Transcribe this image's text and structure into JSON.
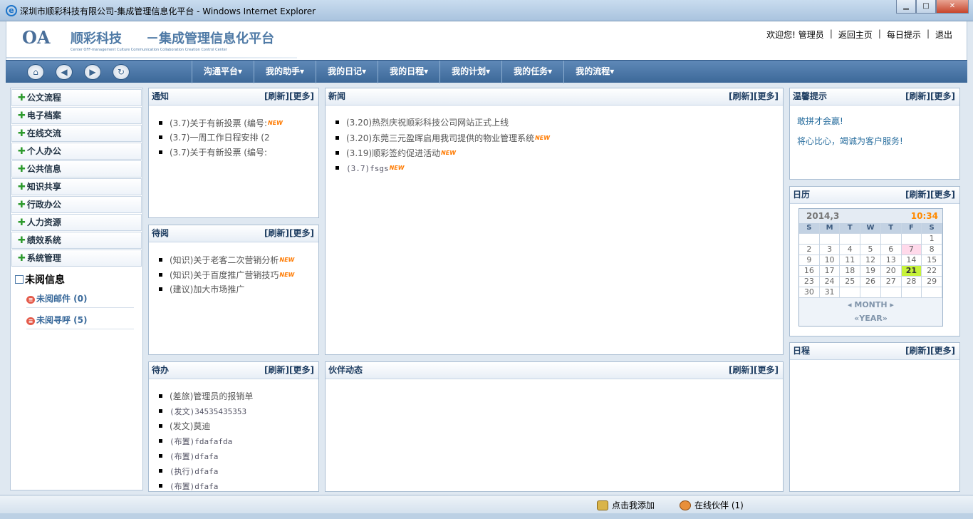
{
  "window": {
    "title": "深圳市顺彩科技有限公司-集成管理信息化平台 - Windows Internet Explorer",
    "minimize": "▁",
    "maximize": "□",
    "close": "✕"
  },
  "header": {
    "logo": "OA",
    "brand": "顺彩科技",
    "subtitle": "－集成管理信息化平台",
    "tagline": "Center OFF-management  Culture Communication Collaboration Creation Control Center",
    "links": {
      "welcome": "欢迎您! 管理员",
      "home": "返回主页",
      "daily_tip": "每日提示",
      "logout": "退出"
    }
  },
  "navbar": {
    "icons": [
      "home-icon",
      "back-icon",
      "forward-icon",
      "refresh-icon"
    ],
    "menu": [
      "沟通平台▾",
      "我的助手▾",
      "我的日记▾",
      "我的日程▾",
      "我的计划▾",
      "我的任务▾",
      "我的流程▾"
    ]
  },
  "sidebar": {
    "items": [
      "公文流程",
      "电子档案",
      "在线交流",
      "个人办公",
      "公共信息",
      "知识共享",
      "行政办公",
      "人力资源",
      "绩效系统",
      "系统管理"
    ],
    "unread_title": "未阅信息",
    "unread": [
      "未阅邮件 (0)",
      "未阅寻呼 (5)"
    ]
  },
  "panel_actions": {
    "refresh": "[刷新]",
    "more": "[更多]"
  },
  "panels": {
    "notice": {
      "title": "通知",
      "items": [
        {
          "text": "(3.7)关于有新投票 (编号:",
          "new": "NEW"
        },
        {
          "text": "(3.7)一周工作日程安排 (2",
          "new": ""
        },
        {
          "text": "(3.7)关于有新投票 (编号:",
          "new": ""
        }
      ]
    },
    "news": {
      "title": "新闻",
      "items": [
        {
          "text": "(3.20)热烈庆祝顺彩科技公司网站正式上线",
          "new": ""
        },
        {
          "text": "(3.20)东莞三元盈晖启用我司提供的物业管理系统",
          "new": "NEW"
        },
        {
          "text": "(3.19)顺彩签约促进活动",
          "new": "NEW"
        },
        {
          "text": "(3.7)fsgs",
          "new": "NEW"
        }
      ]
    },
    "tips": {
      "title": "温馨提示",
      "lines": [
        "敢拼才会赢!",
        "将心比心，竭诚为客户服务!"
      ]
    },
    "pending_read": {
      "title": "待阅",
      "items": [
        {
          "text": "(知识)关于老客二次营销分析",
          "new": "NEW"
        },
        {
          "text": "(知识)关于百度推广营销技巧",
          "new": "NEW"
        },
        {
          "text": "(建议)加大市场推广",
          "new": ""
        }
      ]
    },
    "calendar": {
      "title": "日历",
      "month": "2014,3",
      "time": "10:34",
      "dow": [
        "S",
        "M",
        "T",
        "W",
        "T",
        "F",
        "S"
      ],
      "days": [
        "",
        "",
        "",
        "",
        "",
        "",
        "1",
        "2",
        "3",
        "4",
        "5",
        "6",
        "7",
        "8",
        "9",
        "10",
        "11",
        "12",
        "13",
        "14",
        "15",
        "16",
        "17",
        "18",
        "19",
        "20",
        "21",
        "22",
        "23",
        "24",
        "25",
        "26",
        "27",
        "28",
        "29",
        "30",
        "31",
        "",
        "",
        "",
        "",
        ""
      ],
      "highlight_day": "7",
      "today": "21",
      "nav_month": "◂ MONTH ▸",
      "nav_year": "«YEAR»"
    },
    "todo": {
      "title": "待办",
      "items": [
        {
          "text": "(差旅)管理员的报销单",
          "new": ""
        },
        {
          "text": "(发文)34535435353",
          "new": ""
        },
        {
          "text": "(发文)莫迪",
          "new": ""
        },
        {
          "text": "(布置)fdafafda",
          "new": ""
        },
        {
          "text": "(布置)dfafa",
          "new": ""
        },
        {
          "text": "(执行)dfafa",
          "new": ""
        },
        {
          "text": "(布置)dfafa",
          "new": ""
        }
      ]
    },
    "partner": {
      "title": "伙伴动态"
    },
    "schedule": {
      "title": "日程"
    }
  },
  "statusbar": {
    "add_me": "点击我添加",
    "online": "在线伙伴 (1)"
  }
}
